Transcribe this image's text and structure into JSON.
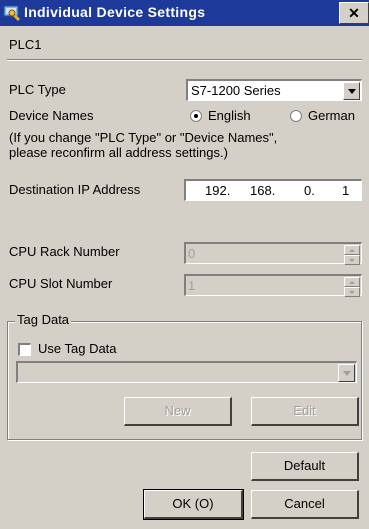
{
  "window": {
    "title": "Individual Device Settings",
    "close_glyph": "✕",
    "icon": "settings-wrench-icon"
  },
  "device_name": "PLC1",
  "plc_type": {
    "label": "PLC Type",
    "value": "S7-1200 Series"
  },
  "device_names": {
    "label": "Device Names",
    "options": [
      "English",
      "German"
    ],
    "selected": "English"
  },
  "note": {
    "line1": "(If you change \"PLC Type\" or \"Device Names\",",
    "line2": "please reconfirm all address settings.)"
  },
  "ip": {
    "label": "Destination IP Address",
    "octets": [
      "192.",
      "168.",
      "0.",
      "1"
    ]
  },
  "cpu_rack": {
    "label": "CPU Rack Number",
    "value": "0"
  },
  "cpu_slot": {
    "label": "CPU Slot Number",
    "value": "1"
  },
  "tag_data": {
    "group_label": "Tag Data",
    "checkbox_label": "Use Tag Data",
    "new_label": "New",
    "edit_label": "Edit"
  },
  "buttons": {
    "default": "Default",
    "ok": "OK (O)",
    "cancel": "Cancel"
  },
  "colors": {
    "titlebar": "#1d3a9a",
    "face": "#d4d0c8"
  }
}
